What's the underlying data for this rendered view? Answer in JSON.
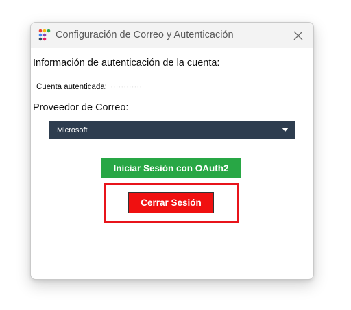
{
  "window": {
    "title": "Configuración de Correo y Autenticación",
    "app_icon": "app-dots-icon",
    "close_icon": "close-icon"
  },
  "auth_section": {
    "heading": "Información de autenticación de la cuenta:",
    "account_label": "Cuenta autenticada:",
    "account_value": "············"
  },
  "provider_section": {
    "label": "Proveedor de Correo:",
    "selected": "Microsoft",
    "dropdown_icon": "dropdown-arrow-icon"
  },
  "buttons": {
    "login_label": "Iniciar Sesión con OAuth2",
    "logout_label": "Cerrar Sesión"
  },
  "colors": {
    "login_button": "#28a745",
    "logout_button": "#f01010",
    "highlight_border": "#e8141b",
    "select_background": "#2e3d4f",
    "titlebar": "#f3f3f3"
  }
}
